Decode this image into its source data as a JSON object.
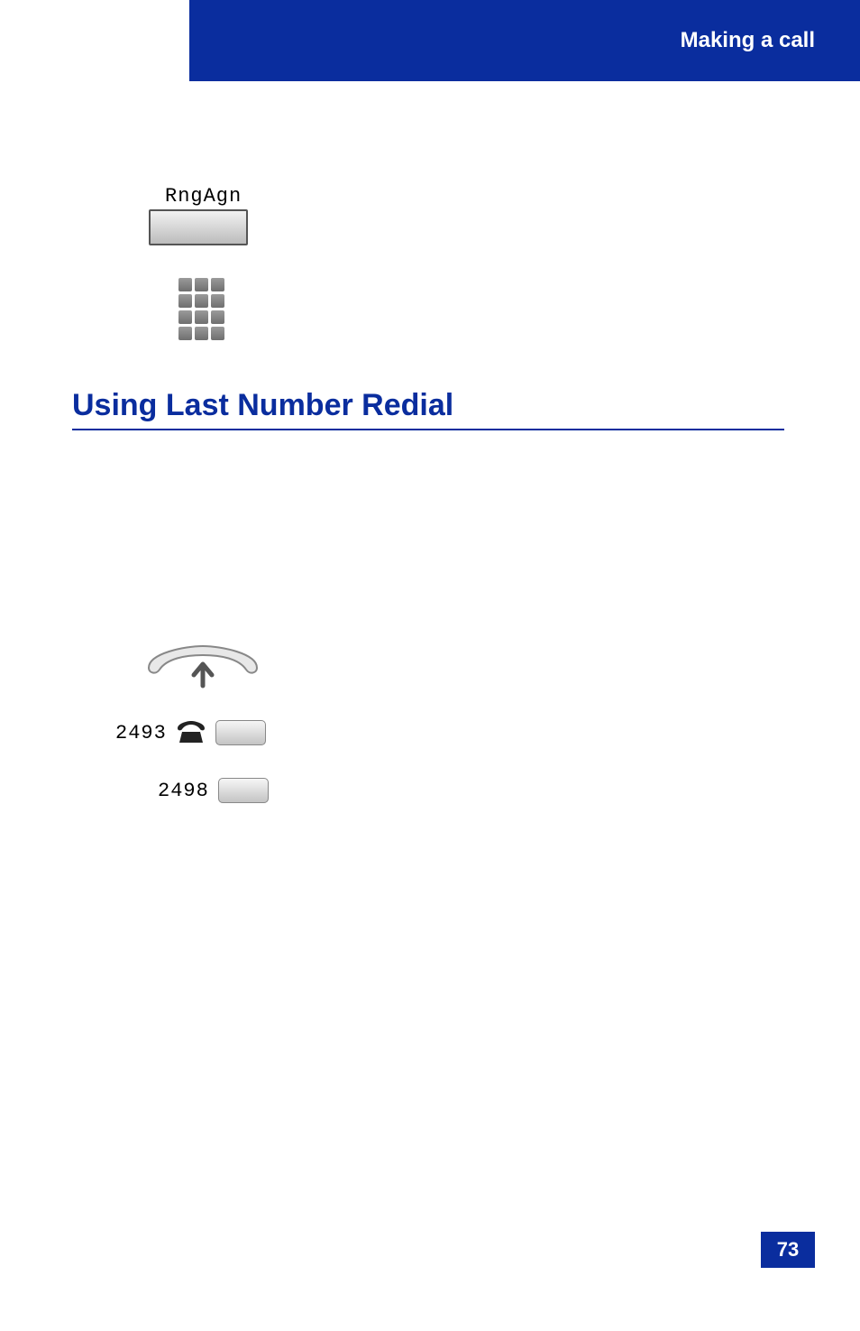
{
  "header": {
    "title": "Making a call"
  },
  "page_number": "73",
  "softkey": {
    "label": "RngAgn"
  },
  "section": {
    "heading": "Using Last Number Redial"
  },
  "lines": {
    "ext1": "2493",
    "ext2": "2498"
  }
}
